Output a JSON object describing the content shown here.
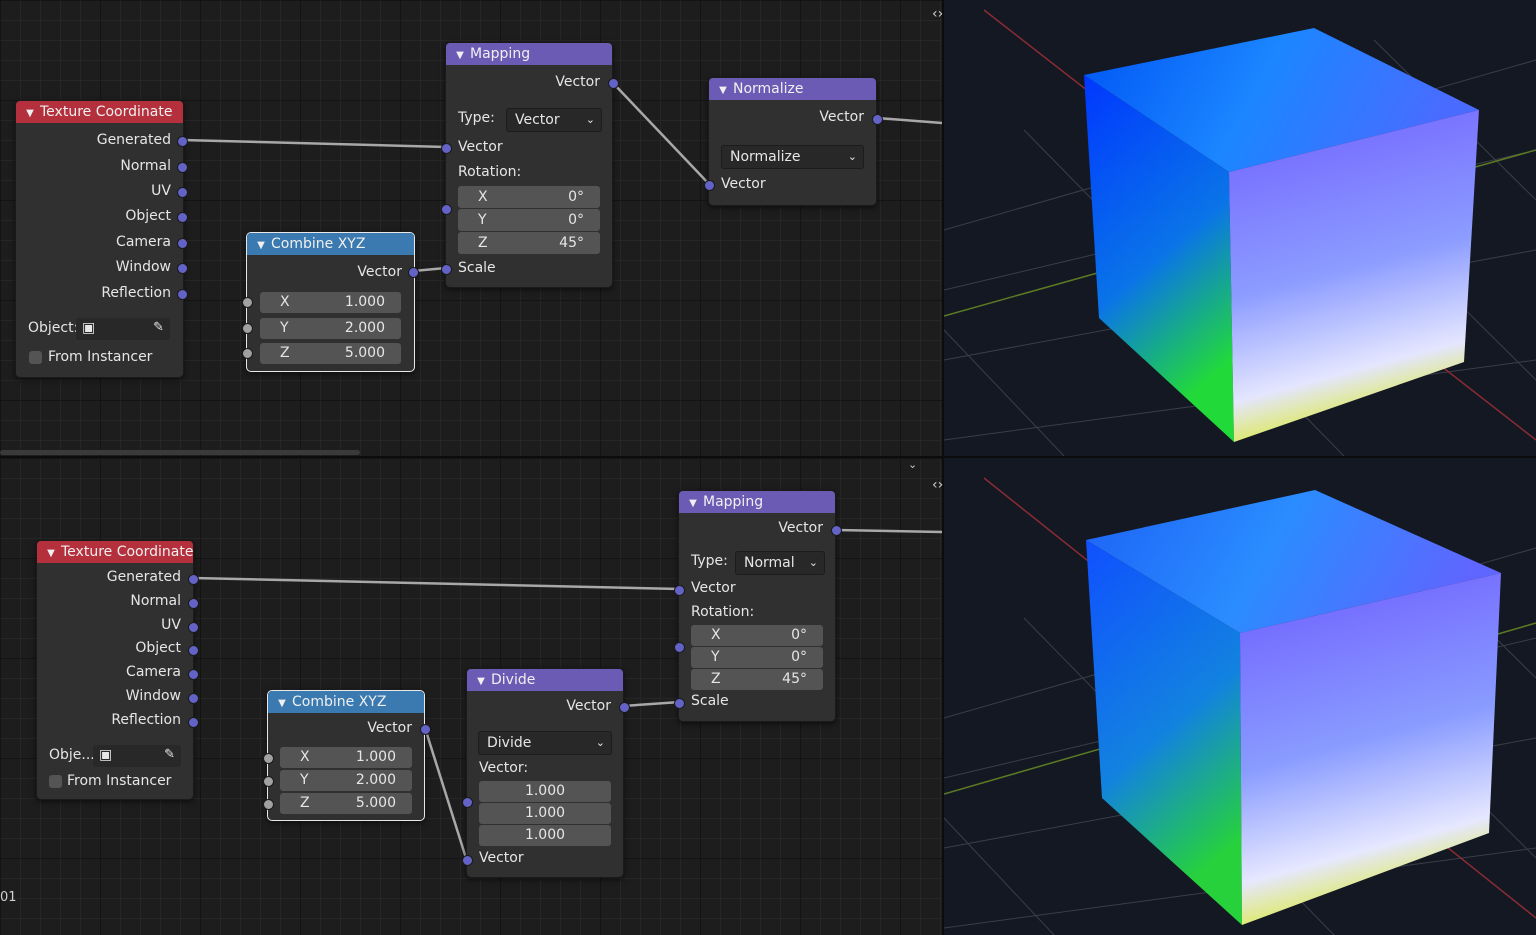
{
  "frame_label": "01",
  "colors": {
    "header_texture_coordinate": "#b3303c",
    "header_vector_node": "#6c5bb5",
    "header_converter": "#3a7ab0",
    "socket_vector": "#6363c7",
    "socket_float": "#a1a1a1",
    "wire": "#a8a8a8"
  },
  "icons": {
    "collapse": "▼",
    "dropdown": "⌄",
    "viewport_toggle": "‹›",
    "panel_collapse": "⌄"
  },
  "top": {
    "texture_coordinate": {
      "title": "Texture Coordinate",
      "outputs": [
        "Generated",
        "Normal",
        "UV",
        "Object",
        "Camera",
        "Window",
        "Reflection"
      ],
      "object_label": "Object:",
      "from_instancer": "From Instancer"
    },
    "combine_xyz": {
      "title": "Combine XYZ",
      "output": "Vector",
      "fields": [
        {
          "k": "X",
          "v": "1.000"
        },
        {
          "k": "Y",
          "v": "2.000"
        },
        {
          "k": "Z",
          "v": "5.000"
        }
      ]
    },
    "mapping": {
      "title": "Mapping",
      "output": "Vector",
      "type_label": "Type:",
      "type_value": "Vector",
      "vector_label": "Vector",
      "rotation_label": "Rotation:",
      "rotation": [
        {
          "k": "X",
          "v": "0°"
        },
        {
          "k": "Y",
          "v": "0°"
        },
        {
          "k": "Z",
          "v": "45°"
        }
      ],
      "scale_label": "Scale"
    },
    "normalize": {
      "title": "Normalize",
      "output": "Vector",
      "operation": "Normalize",
      "input": "Vector"
    }
  },
  "bottom": {
    "texture_coordinate": {
      "title": "Texture Coordinate",
      "outputs": [
        "Generated",
        "Normal",
        "UV",
        "Object",
        "Camera",
        "Window",
        "Reflection"
      ],
      "object_label": "Obje...",
      "from_instancer": "From Instancer"
    },
    "combine_xyz": {
      "title": "Combine XYZ",
      "output": "Vector",
      "fields": [
        {
          "k": "X",
          "v": "1.000"
        },
        {
          "k": "Y",
          "v": "2.000"
        },
        {
          "k": "Z",
          "v": "5.000"
        }
      ]
    },
    "divide": {
      "title": "Divide",
      "output": "Vector",
      "operation": "Divide",
      "vector_label": "Vector:",
      "values": [
        "1.000",
        "1.000",
        "1.000"
      ],
      "input": "Vector"
    },
    "mapping": {
      "title": "Mapping",
      "output": "Vector",
      "type_label": "Type:",
      "type_value": "Normal",
      "vector_label": "Vector",
      "rotation_label": "Rotation:",
      "rotation": [
        {
          "k": "X",
          "v": "0°"
        },
        {
          "k": "Y",
          "v": "0°"
        },
        {
          "k": "Z",
          "v": "45°"
        }
      ],
      "scale_label": "Scale"
    }
  }
}
